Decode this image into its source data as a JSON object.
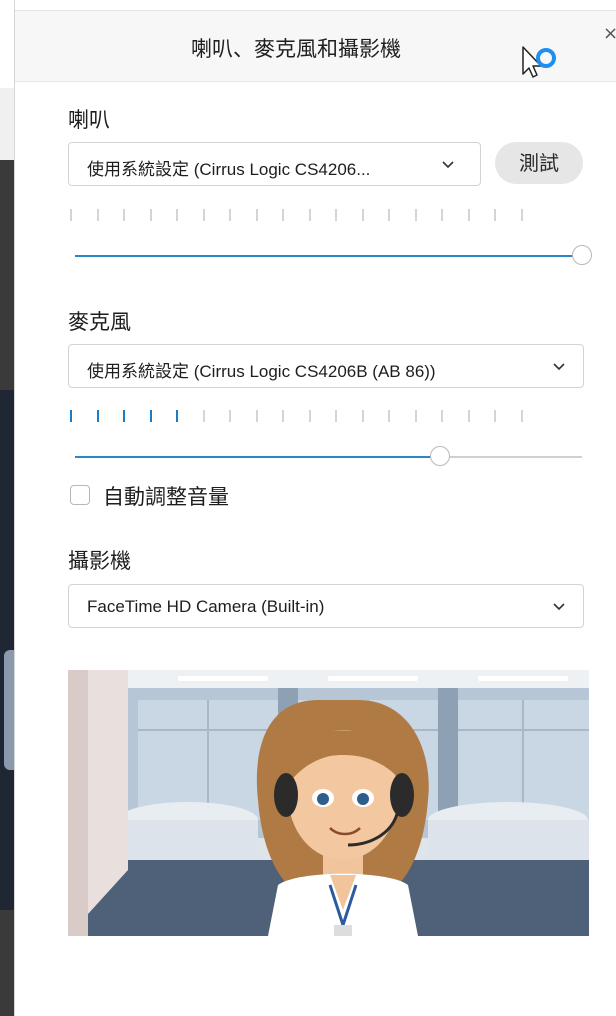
{
  "dialog": {
    "title": "喇叭、麥克風和攝影機",
    "close_glyph": "×"
  },
  "speaker": {
    "label": "喇叭",
    "device": "使用系統設定 (Cirrus Logic CS4206...",
    "test_label": "測試",
    "level_segments_total": 18,
    "level_segments_active": 0,
    "volume": 1.0
  },
  "microphone": {
    "label": "麥克風",
    "device": "使用系統設定 (Cirrus Logic CS4206B (AB 86))",
    "level_segments_total": 18,
    "level_segments_active": 5,
    "volume": 0.72,
    "auto_adjust_label": "自動調整音量",
    "auto_adjust_checked": false
  },
  "camera": {
    "label": "攝影機",
    "device": "FaceTime HD Camera (Built-in)",
    "preview_icon": "avatar-office-preview"
  },
  "colors": {
    "accent": "#2b88c8",
    "level_active": "#1a7dc4",
    "header_bg": "#f7f7f7"
  }
}
